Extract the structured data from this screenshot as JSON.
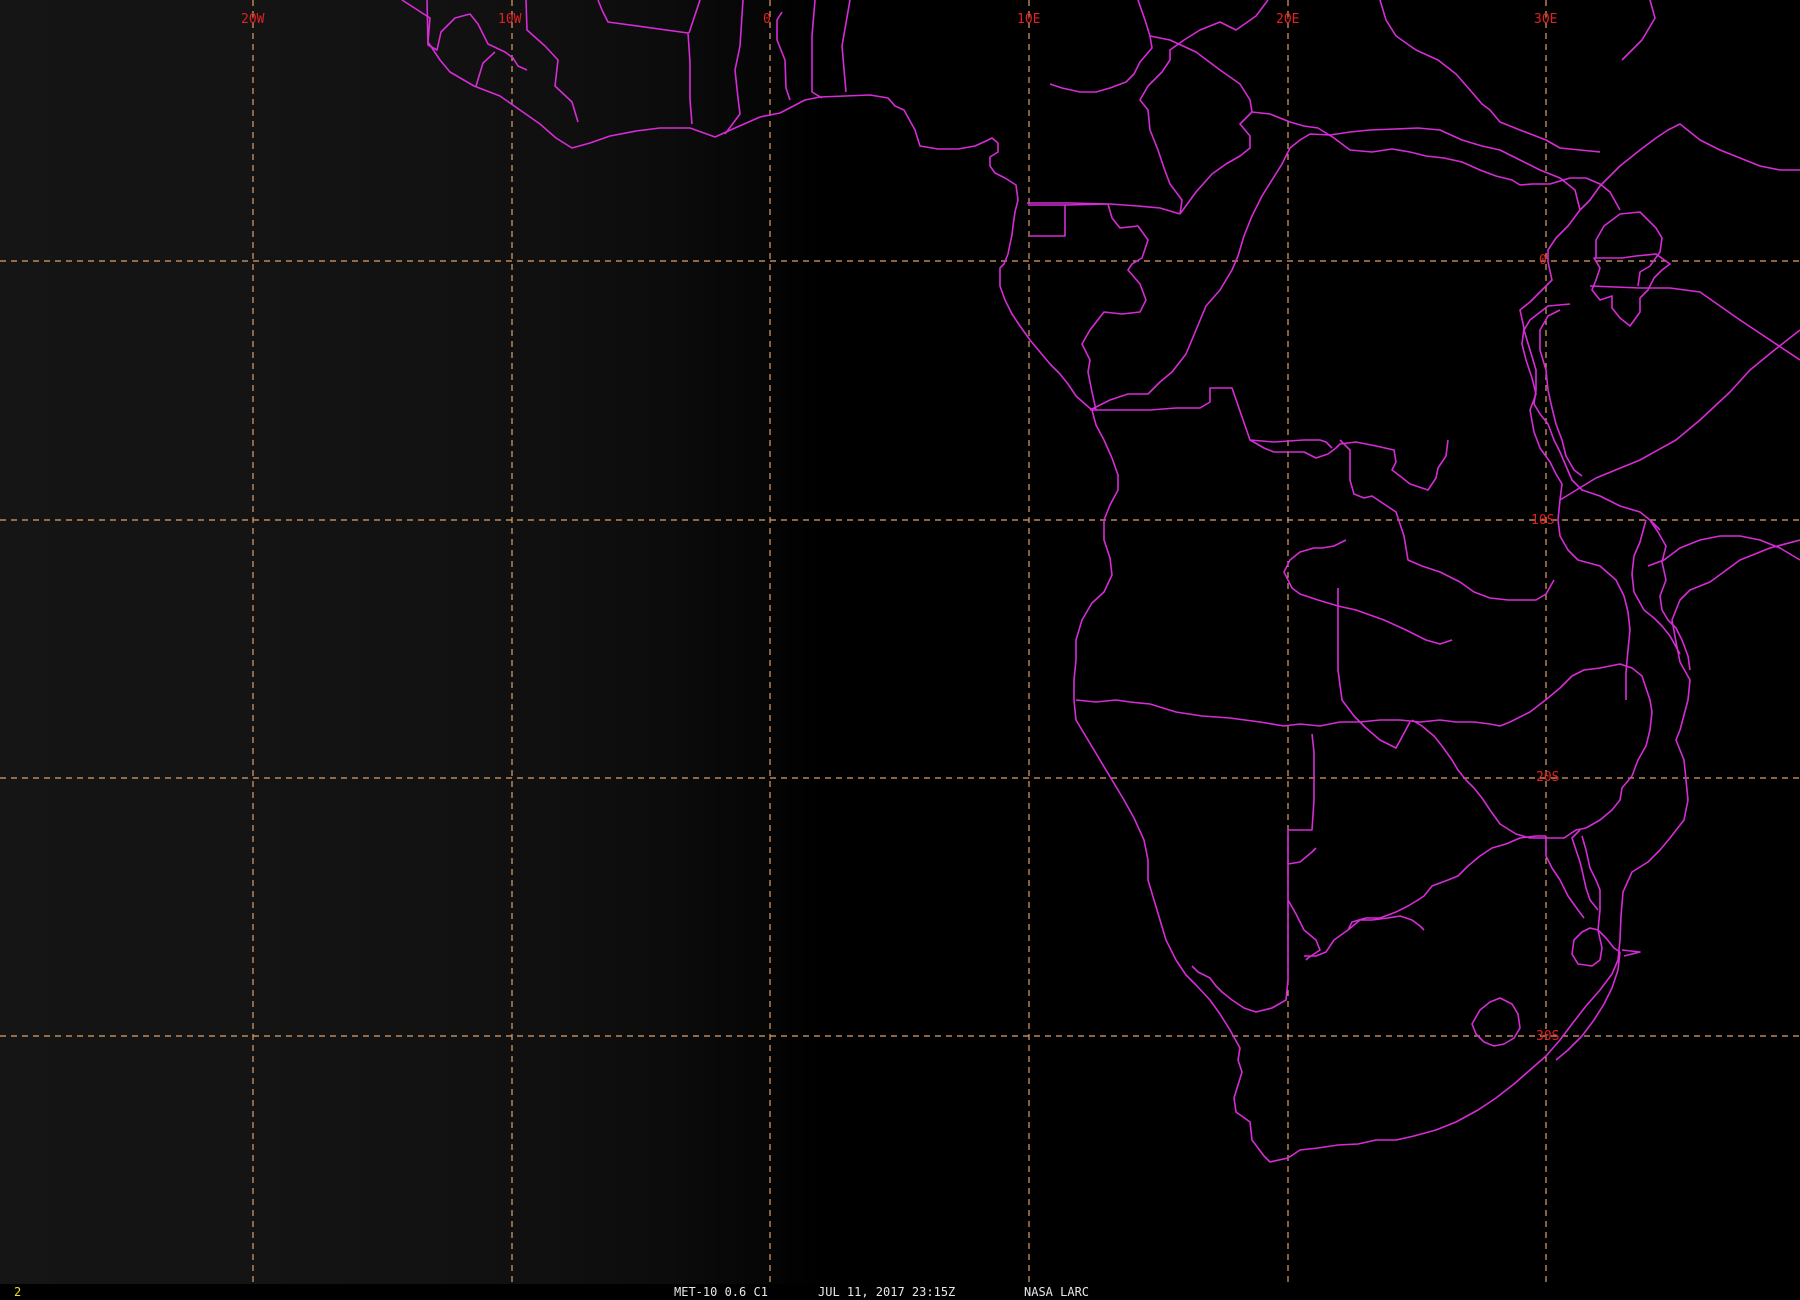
{
  "map": {
    "lon_labels": [
      "20W",
      "10W",
      "0",
      "10E",
      "20E",
      "30E"
    ],
    "lat_labels": [
      "0",
      "10S",
      "20S",
      "30S"
    ],
    "colors": {
      "borders": "#d62cd6",
      "grid": "#e0a068",
      "labels": "#e02222",
      "frame_number": "#e8e020"
    }
  },
  "status": {
    "frame_number": "2",
    "satellite": "MET-10 0.6 C1",
    "timestamp": "JUL 11, 2017 23:15Z",
    "organization": "NASA LARC"
  }
}
